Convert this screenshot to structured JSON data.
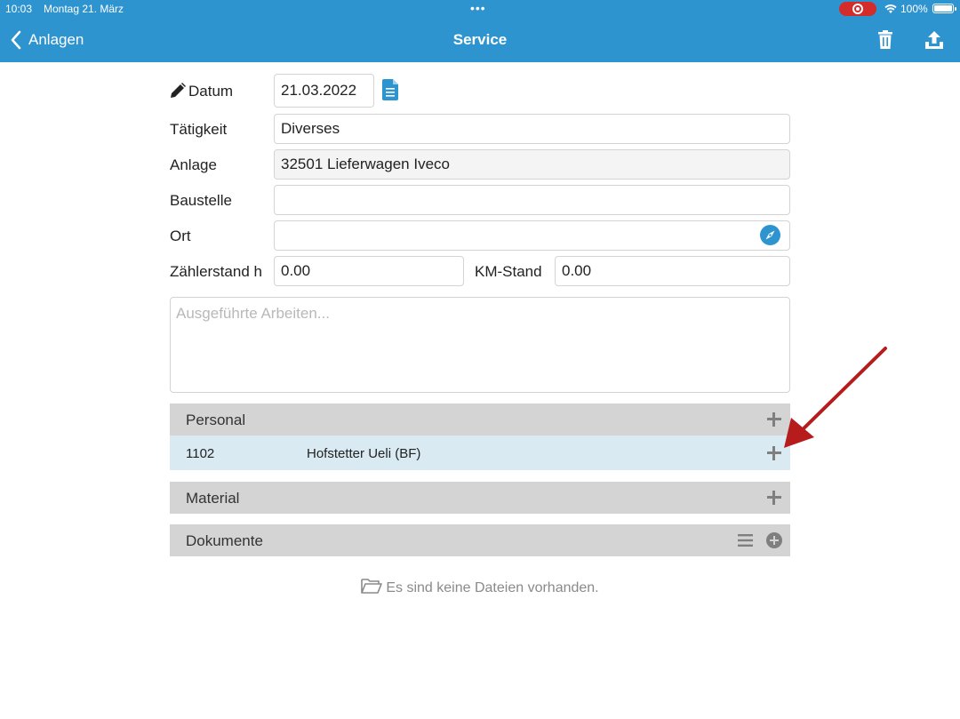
{
  "status_bar": {
    "time": "10:03",
    "date": "Montag 21. März",
    "battery": "100%"
  },
  "nav": {
    "back_label": "Anlagen",
    "title": "Service"
  },
  "form": {
    "datum_label": "Datum",
    "datum_value": "21.03.2022",
    "taetigkeit_label": "Tätigkeit",
    "taetigkeit_value": "Diverses",
    "anlage_label": "Anlage",
    "anlage_value": "32501 Lieferwagen Iveco",
    "baustelle_label": "Baustelle",
    "baustelle_value": "",
    "ort_label": "Ort",
    "ort_value": "",
    "zaehlerstand_label": "Zählerstand h",
    "zaehlerstand_value": "0.00",
    "km_label": "KM-Stand",
    "km_value": "0.00",
    "arbeiten_placeholder": "Ausgeführte Arbeiten..."
  },
  "sections": {
    "personal": {
      "label": "Personal",
      "rows": [
        {
          "number": "1102",
          "name": "Hofstetter Ueli (BF)"
        }
      ]
    },
    "material": {
      "label": "Material"
    },
    "dokumente": {
      "label": "Dokumente",
      "empty_text": "Es sind keine Dateien vorhanden."
    }
  },
  "colors": {
    "header": "#2e94d0",
    "section_bg": "#d4d4d4",
    "selected_row": "#daeaf2",
    "annotation_arrow": "#b71c1c"
  }
}
